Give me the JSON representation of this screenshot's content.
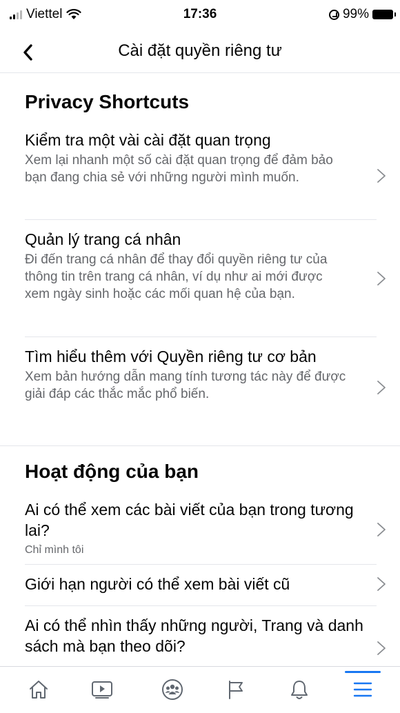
{
  "status_bar": {
    "carrier": "Viettel",
    "time": "17:36",
    "battery": "99%"
  },
  "header": {
    "title": "Cài đặt quyền riêng tư"
  },
  "sections": [
    {
      "heading": "Privacy Shortcuts",
      "items": [
        {
          "title": "Kiểm tra một vài cài đặt quan trọng",
          "description": "Xem lại nhanh một số cài đặt quan trọng để đảm bảo bạn đang chia sẻ với những người mình muốn."
        },
        {
          "title": "Quản lý trang cá nhân",
          "description": "Đi đến trang cá nhân để thay đổi quyền riêng tư của thông tin trên trang cá nhân, ví dụ như ai mới được xem ngày sinh hoặc các mối quan hệ của bạn."
        },
        {
          "title": "Tìm hiểu thêm với Quyền riêng tư cơ bản",
          "description": "Xem bản hướng dẫn mang tính tương tác này để được giải đáp các thắc mắc phổ biến."
        }
      ]
    },
    {
      "heading": "Hoạt động của bạn",
      "items": [
        {
          "title": "Ai có thể xem các bài viết của bạn trong tương lai?",
          "subtitle": "Chỉ mình tôi"
        },
        {
          "title": "Giới hạn người có thể xem bài viết cũ"
        },
        {
          "title": "Ai có thể nhìn thấy những người, Trang và danh sách mà bạn theo dõi?"
        }
      ]
    }
  ],
  "tab_bar": {
    "icons": [
      "home-icon",
      "watch-icon",
      "groups-icon",
      "pages-flag-icon",
      "notifications-bell-icon",
      "menu-icon"
    ],
    "active": "menu-icon",
    "accent_color": "#1877f2"
  }
}
